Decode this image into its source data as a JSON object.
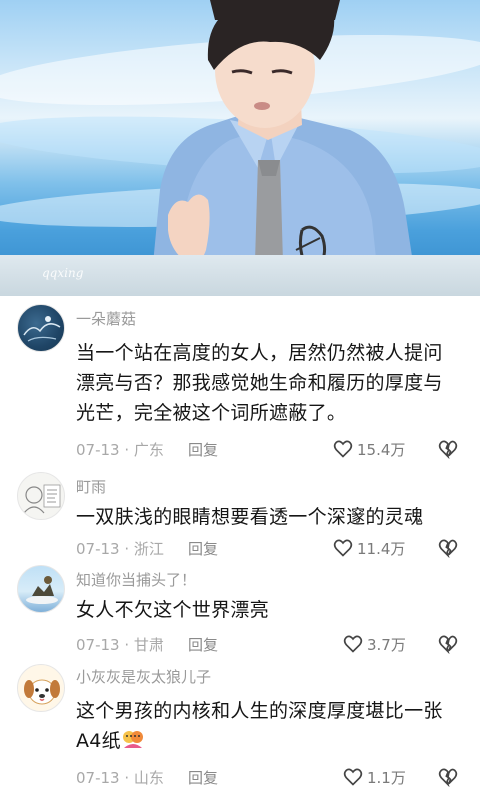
{
  "video": {
    "watermark": "qqxing"
  },
  "comments": [
    {
      "username": "一朵蘑菇",
      "lines": [
        "当一个站在高度的女人，居然仍然被人提问",
        "漂亮与否？那我感觉她生命和履历的厚度与",
        "光芒，完全被这个词所遮蔽了。"
      ],
      "date": "07-13 · 广东",
      "reply_label": "回复",
      "likes": "15.4万",
      "avatar_icon": "ink-painting-avatar"
    },
    {
      "username": "町雨",
      "lines": [
        "一双肤浅的眼睛想要看透一个深邃的灵魂"
      ],
      "date": "07-13 · 浙江",
      "reply_label": "回复",
      "likes": "11.4万",
      "avatar_icon": "sketch-avatar"
    },
    {
      "username": "知道你当捕头了！",
      "lines": [
        "女人不欠这个世界漂亮"
      ],
      "date": "07-13 · 甘肃",
      "reply_label": "回复",
      "likes": "3.7万",
      "avatar_icon": "landscape-avatar"
    },
    {
      "username": "小灰灰是灰太狼儿子",
      "lines": [
        "这个男孩的内核和人生的深度厚度堪比一张",
        "A4纸"
      ],
      "date": "07-13 · 山东",
      "reply_label": "回复",
      "likes": "1.1万",
      "avatar_icon": "puppy-avatar"
    }
  ],
  "colors": {
    "username": "#9a9a9a",
    "body_text": "#161616",
    "meta_text": "#a8a8a8"
  }
}
